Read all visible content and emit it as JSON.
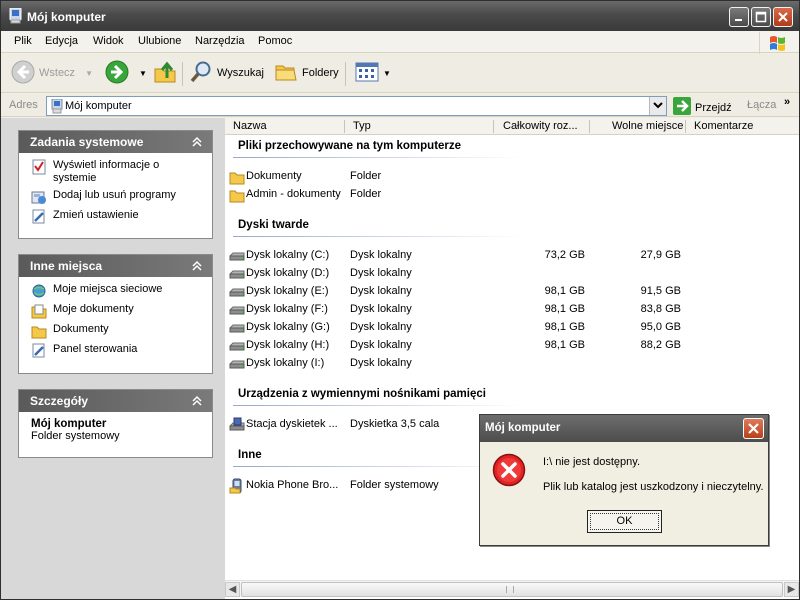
{
  "window": {
    "title": "Mój komputer"
  },
  "menu": [
    "Plik",
    "Edycja",
    "Widok",
    "Ulubione",
    "Narzędzia",
    "Pomoc"
  ],
  "toolbar": {
    "back_label": "Wstecz",
    "search_label": "Wyszukaj",
    "folders_label": "Foldery"
  },
  "address": {
    "label": "Adres",
    "value": "Mój komputer",
    "go_label": "Przejdź",
    "links_label": "Łącza"
  },
  "sidebar": {
    "tasks": {
      "title": "Zadania systemowe",
      "items": [
        "Wyświetl informacje o systemie",
        "Dodaj lub usuń programy",
        "Zmień ustawienie"
      ]
    },
    "places": {
      "title": "Inne miejsca",
      "items": [
        "Moje miejsca sieciowe",
        "Moje dokumenty",
        "Dokumenty",
        "Panel sterowania"
      ]
    },
    "details": {
      "title": "Szczegóły",
      "name": "Mój komputer",
      "type": "Folder systemowy"
    }
  },
  "columns": [
    "Nazwa",
    "Typ",
    "Całkowity roz...",
    "Wolne miejsce",
    "Komentarze"
  ],
  "groups": {
    "files": "Pliki przechowywane na tym komputerze",
    "hdd": "Dyski twarde",
    "removable": "Urządzenia z wymiennymi nośnikami pamięci",
    "other": "Inne"
  },
  "files": [
    {
      "name": "Dokumenty",
      "type": "Folder"
    },
    {
      "name": "Admin - dokumenty",
      "type": "Folder"
    }
  ],
  "drives": [
    {
      "name": "Dysk lokalny (C:)",
      "type": "Dysk lokalny",
      "total": "73,2 GB",
      "free": "27,9 GB"
    },
    {
      "name": "Dysk lokalny (D:)",
      "type": "Dysk lokalny",
      "total": "",
      "free": ""
    },
    {
      "name": "Dysk lokalny (E:)",
      "type": "Dysk lokalny",
      "total": "98,1 GB",
      "free": "91,5 GB"
    },
    {
      "name": "Dysk lokalny (F:)",
      "type": "Dysk lokalny",
      "total": "98,1 GB",
      "free": "83,8 GB"
    },
    {
      "name": "Dysk lokalny (G:)",
      "type": "Dysk lokalny",
      "total": "98,1 GB",
      "free": "95,0 GB"
    },
    {
      "name": "Dysk lokalny (H:)",
      "type": "Dysk lokalny",
      "total": "98,1 GB",
      "free": "88,2 GB"
    },
    {
      "name": "Dysk lokalny (I:)",
      "type": "Dysk lokalny",
      "total": "",
      "free": ""
    }
  ],
  "removable": [
    {
      "name": "Stacja dyskietek ...",
      "type": "Dyskietka 3,5 cala"
    }
  ],
  "other": [
    {
      "name": "Nokia Phone Bro...",
      "type": "Folder systemowy"
    }
  ],
  "dialog": {
    "title": "Mój komputer",
    "message": "I:\\ nie jest dostępny.",
    "detail": "Plik lub katalog jest uszkodzony i nieczytelny.",
    "ok_label": "OK"
  }
}
